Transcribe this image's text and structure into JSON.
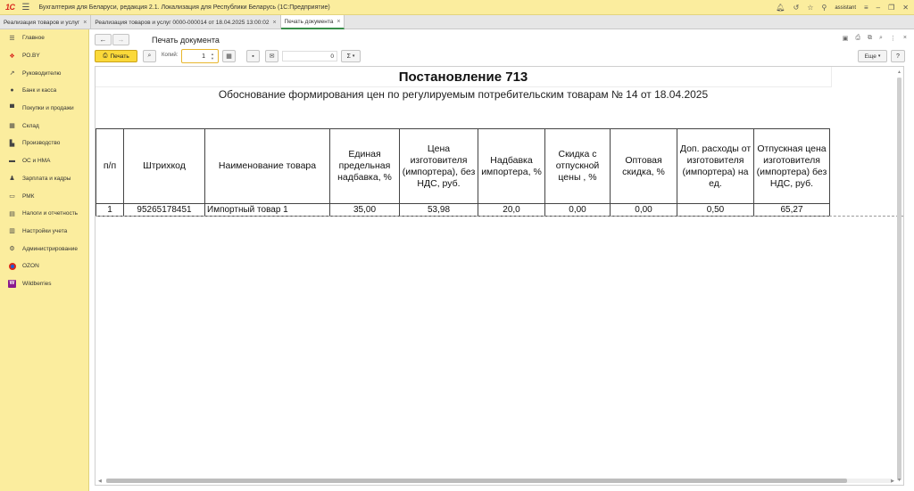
{
  "titlebar": {
    "logo": "1С",
    "title": "Бухгалтерия для Беларуси, редакция 2.1. Локализация для Республики Беларусь   (1С:Предприятие)",
    "user": "assistant"
  },
  "tabs": [
    {
      "label": "Реализация товаров и услуг"
    },
    {
      "label": "Реализация товаров и услуг 0000-000014 от 18.04.2025 13:00:02"
    },
    {
      "label": "Печать документа"
    }
  ],
  "sidebar": {
    "items": [
      {
        "label": "Главное",
        "icon": "menu-icon"
      },
      {
        "label": "РО.BY",
        "icon": "ro-by-icon"
      },
      {
        "label": "Руководителю",
        "icon": "chart-trend-icon"
      },
      {
        "label": "Банк и касса",
        "icon": "coins-icon"
      },
      {
        "label": "Покупки и продажи",
        "icon": "cart-icon"
      },
      {
        "label": "Склад",
        "icon": "warehouse-icon"
      },
      {
        "label": "Производство",
        "icon": "factory-icon"
      },
      {
        "label": "ОС и НМА",
        "icon": "truck-icon"
      },
      {
        "label": "Зарплата и кадры",
        "icon": "people-icon"
      },
      {
        "label": "РМК",
        "icon": "register-icon"
      },
      {
        "label": "Налоги и отчетность",
        "icon": "tax-report-icon"
      },
      {
        "label": "Настройки учета",
        "icon": "settings-doc-icon"
      },
      {
        "label": "Администрирование",
        "icon": "gear-icon"
      },
      {
        "label": "OZON",
        "icon": "ozon-icon"
      },
      {
        "label": "Wildberries",
        "icon": "wildberries-icon"
      }
    ]
  },
  "header": {
    "title": "Печать документа"
  },
  "toolbar": {
    "print_label": "Печать",
    "copies_label": "Копий:",
    "copies_value": "1",
    "sum_value": "0",
    "sum_symbol": "Σ",
    "more_label": "Еще",
    "help_label": "?"
  },
  "document": {
    "title": "Постановление 713",
    "subtitle": "Обоснование формирования цен по регулируемым потребительским товарам № 14 от 18.04.2025",
    "columns": [
      "п/п",
      "Штрихкод",
      "Наименование товара",
      "Единая предельная надбавка, %",
      "Цена изготовителя (импортера), без НДС, руб.",
      "Надбавка импортера, %",
      "Скидка с отпускной цены , %",
      "Оптовая скидка, %",
      "Доп. расходы от изготовителя (импортера) на ед.",
      "Отпускная цена изготовителя (импортера) без НДС, руб."
    ],
    "rows": [
      [
        "1",
        "95265178451",
        "Импортный товар 1",
        "35,00",
        "53,98",
        "20,0",
        "0,00",
        "0,00",
        "0,50",
        "65,27"
      ]
    ]
  }
}
